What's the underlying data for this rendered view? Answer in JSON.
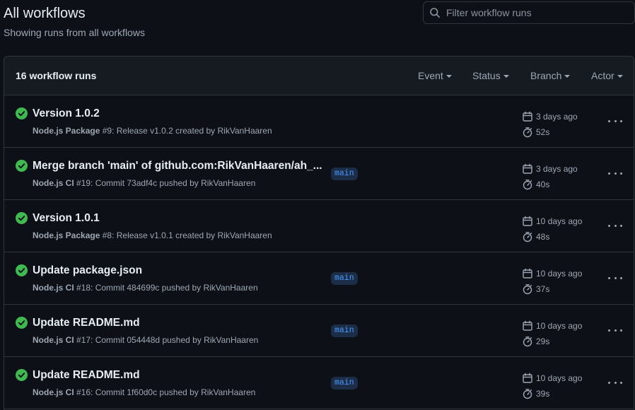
{
  "page": {
    "title": "All workflows",
    "subtitle": "Showing runs from all workflows"
  },
  "search": {
    "placeholder": "Filter workflow runs"
  },
  "runs_header": {
    "count_label": "16 workflow runs",
    "filters": [
      "Event",
      "Status",
      "Branch",
      "Actor"
    ]
  },
  "colors": {
    "success": "#3fb950",
    "branch_badge_bg": "#1b2d47",
    "branch_badge_text": "#4c9aff"
  },
  "runs": [
    {
      "title": "Version 1.0.2",
      "workflow": "Node.js Package",
      "detail": "#9: Release v1.0.2 created by RikVanHaaren",
      "branch": "",
      "when": "3 days ago",
      "duration": "52s",
      "status": "success"
    },
    {
      "title": "Merge branch 'main' of github.com:RikVanHaaren/ah_...",
      "workflow": "Node.js CI",
      "detail": "#19: Commit 73adf4c pushed by RikVanHaaren",
      "branch": "main",
      "when": "3 days ago",
      "duration": "40s",
      "status": "success"
    },
    {
      "title": "Version 1.0.1",
      "workflow": "Node.js Package",
      "detail": "#8: Release v1.0.1 created by RikVanHaaren",
      "branch": "",
      "when": "10 days ago",
      "duration": "48s",
      "status": "success"
    },
    {
      "title": "Update package.json",
      "workflow": "Node.js CI",
      "detail": "#18: Commit 484699c pushed by RikVanHaaren",
      "branch": "main",
      "when": "10 days ago",
      "duration": "37s",
      "status": "success"
    },
    {
      "title": "Update README.md",
      "workflow": "Node.js CI",
      "detail": "#17: Commit 054448d pushed by RikVanHaaren",
      "branch": "main",
      "when": "10 days ago",
      "duration": "29s",
      "status": "success"
    },
    {
      "title": "Update README.md",
      "workflow": "Node.js CI",
      "detail": "#16: Commit 1f60d0c pushed by RikVanHaaren",
      "branch": "main",
      "when": "10 days ago",
      "duration": "39s",
      "status": "success"
    }
  ]
}
